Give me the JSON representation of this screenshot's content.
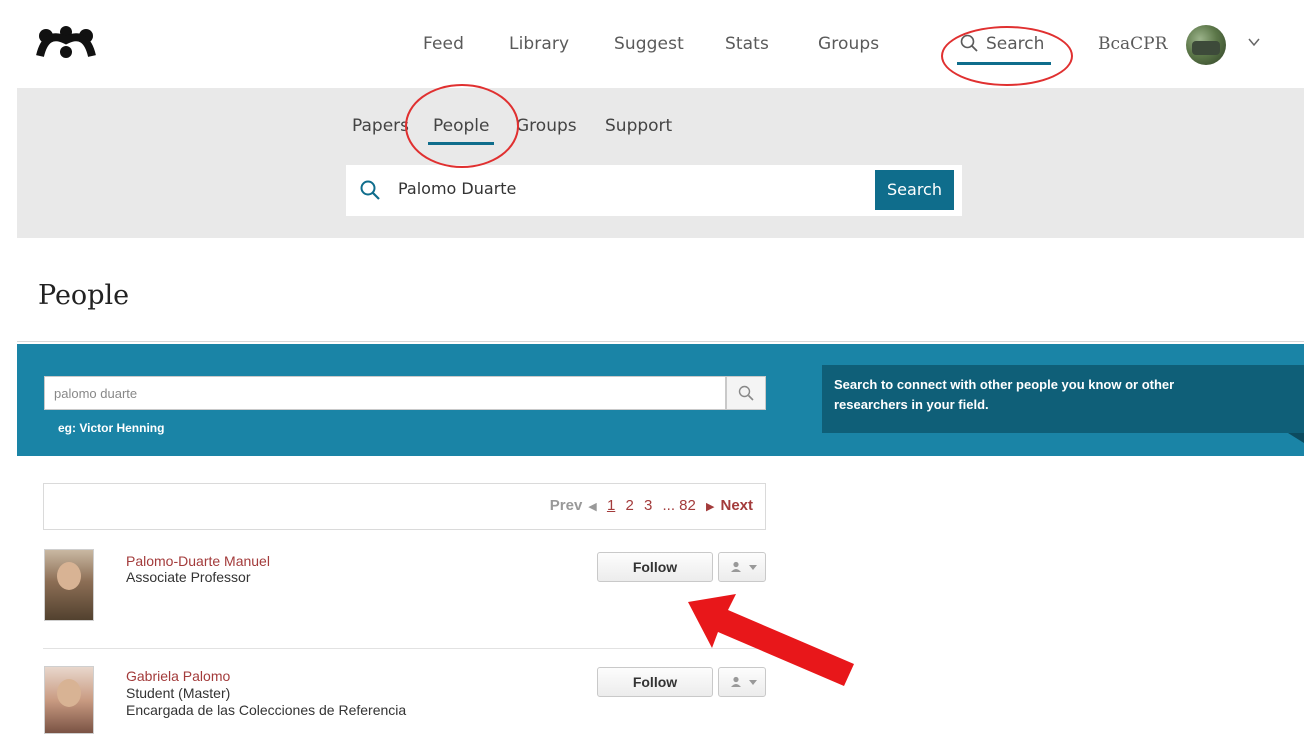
{
  "nav": {
    "items": [
      "Feed",
      "Library",
      "Suggest",
      "Stats",
      "Groups"
    ],
    "search_label": "Search",
    "user": "BcaCPR"
  },
  "subtabs": [
    "Papers",
    "People",
    "Groups",
    "Support"
  ],
  "search": {
    "value": "Palomo Duarte",
    "button": "Search"
  },
  "people": {
    "title": "People",
    "input_value": "palomo duarte",
    "example": "eg: Victor Henning",
    "tip": "Search to connect with other people you know or other researchers in your field."
  },
  "pager": {
    "prev": "Prev",
    "pages": [
      "1",
      "2",
      "3"
    ],
    "ellipsis": "... 82",
    "next": "Next"
  },
  "results": [
    {
      "name": "Palomo-Duarte Manuel",
      "role": "Associate Professor",
      "role2": "",
      "follow": "Follow"
    },
    {
      "name": "Gabriela Palomo",
      "role": "Student (Master)",
      "role2": "Encargada de las Colecciones de Referencia",
      "follow": "Follow"
    }
  ],
  "colors": {
    "accent": "#0f6d8c",
    "teal_band": "#1a84a6",
    "link": "#a33b3b",
    "annotation": "#e03030"
  }
}
